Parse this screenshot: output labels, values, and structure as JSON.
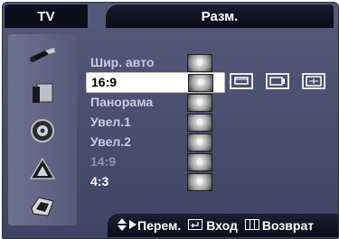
{
  "header": {
    "source_label": "TV",
    "menu_title": "Разм."
  },
  "sidebar": {
    "icons": [
      "input-icon",
      "picture-icon",
      "sound-icon",
      "channel-icon",
      "setup-icon"
    ]
  },
  "menu": {
    "items": [
      {
        "label": "Шир. авто",
        "state": "dim"
      },
      {
        "label": "16:9",
        "state": "selected"
      },
      {
        "label": "Панорама",
        "state": "dim"
      },
      {
        "label": "Увел.1",
        "state": "dim"
      },
      {
        "label": "Увел.2",
        "state": "dim"
      },
      {
        "label": "14:9",
        "state": "faded"
      },
      {
        "label": "4:3",
        "state": "bright"
      }
    ]
  },
  "footer": {
    "move_label": "Перем.",
    "enter_label": "Вход",
    "return_label": "Возврат"
  },
  "colors": {
    "panel": "#4c5070",
    "bar": "#0c0e1c",
    "selected_bg": "#ffffff"
  }
}
